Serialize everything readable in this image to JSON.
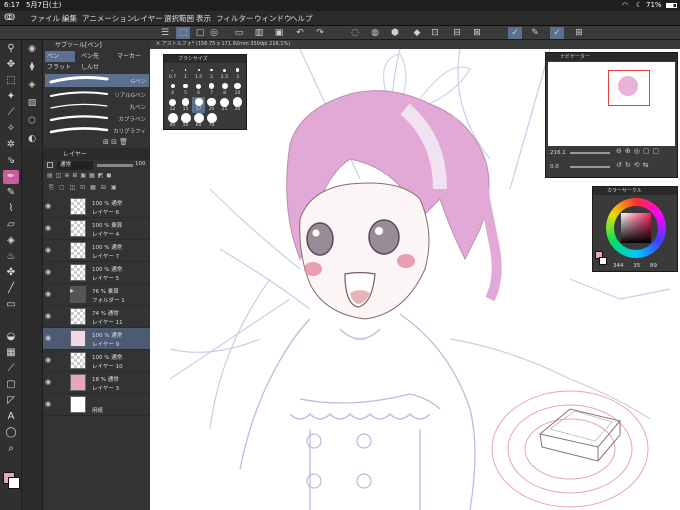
{
  "status": {
    "time": "6:17",
    "date": "5月7日(土)",
    "battery": "71%"
  },
  "menu": [
    "ファイル",
    "編集",
    "アニメーション",
    "レイヤー",
    "選択範囲",
    "表示",
    "フィルター",
    "ウィンドウ",
    "ヘルプ"
  ],
  "canvas_tab": "アストルフォ* (156.75 x 171.92mm 350dpi 216.1%)",
  "brush_panel": {
    "title": "サブツール[ペン]",
    "tabs": [
      "ペン",
      "ペン先",
      "マーカー",
      "フラット",
      "しんせ"
    ],
    "brushes": [
      "Gペン",
      "リアルGペン",
      "丸ペン",
      "カブラペン",
      "カリグラフィ"
    ]
  },
  "layer_panel": {
    "title": "レイヤー",
    "blend": "通常",
    "opacity": "100",
    "layers": [
      {
        "line1": "100 % 通常",
        "line2": "レイヤー 6",
        "thumb": "check",
        "selected": false
      },
      {
        "line1": "100 % 乗算",
        "line2": "レイヤー 4",
        "thumb": "check",
        "selected": false
      },
      {
        "line1": "100 % 通常",
        "line2": "レイヤー 7",
        "thumb": "check",
        "selected": false
      },
      {
        "line1": "100 % 通常",
        "line2": "レイヤー 5",
        "thumb": "check",
        "selected": false
      },
      {
        "line1": "76 % 乗算",
        "line2": "フォルダー 1",
        "thumb": "folder",
        "selected": false
      },
      {
        "line1": "74 % 通常",
        "line2": "レイヤー 11",
        "thumb": "check",
        "selected": false
      },
      {
        "line1": "100 % 通常",
        "line2": "レイヤー 9",
        "thumb": "sketch",
        "selected": true
      },
      {
        "line1": "100 % 通常",
        "line2": "レイヤー 10",
        "thumb": "check",
        "selected": false
      },
      {
        "line1": "18 % 通常",
        "line2": "レイヤー 3",
        "thumb": "pink",
        "selected": false
      },
      {
        "line1": "",
        "line2": "用紙",
        "thumb": "white",
        "selected": false
      }
    ]
  },
  "brush_size": {
    "title": "ブラシサイズ",
    "sizes": [
      "0.7",
      "1",
      "1.5",
      "2",
      "2.5",
      "3",
      "4",
      "5",
      "6",
      "7",
      "8",
      "10",
      "12",
      "15",
      "17",
      "20",
      "25",
      "30",
      "40",
      "50",
      "60",
      "70"
    ]
  },
  "navigator": {
    "title": "ナビゲーター",
    "zoom": "216.1",
    "angle": "0.0"
  },
  "color_circle": {
    "title": "カラーサークル",
    "h": "344",
    "s": "35",
    "v": "89"
  },
  "colors": {
    "main": "#e7a6bf",
    "sub": "#ffffff",
    "accent": "#5b6f8f"
  }
}
